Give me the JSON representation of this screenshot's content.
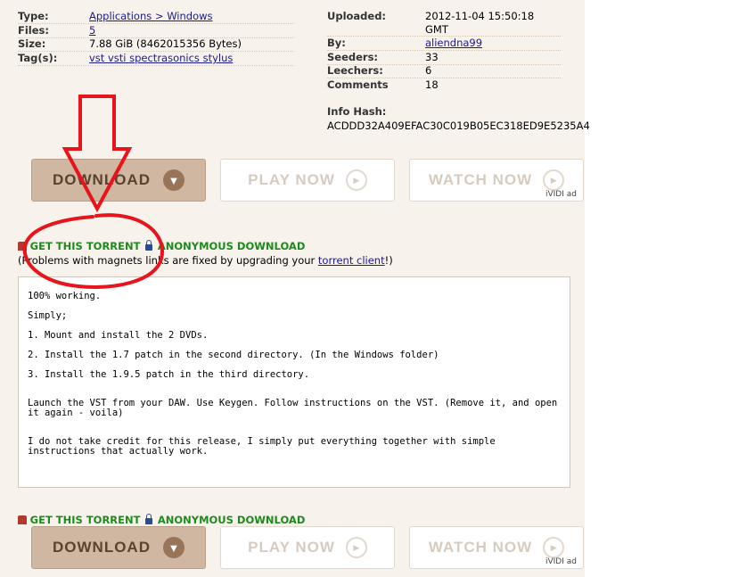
{
  "details_left": {
    "type_label": "Type:",
    "type_value": "Applications > Windows",
    "files_label": "Files:",
    "files_value": "5",
    "size_label": "Size:",
    "size_value": "7.88 GiB (8462015356 Bytes)",
    "tags_label": "Tag(s):",
    "tags_value": "vst vsti spectrasonics stylus"
  },
  "details_right": {
    "uploaded_label": "Uploaded:",
    "uploaded_value": "2012-11-04 15:50:18",
    "uploaded_tz": "GMT",
    "by_label": "By:",
    "by_value": "aliendna99",
    "seeders_label": "Seeders:",
    "seeders_value": "33",
    "leechers_label": "Leechers:",
    "leechers_value": "6",
    "comments_label": "Comments",
    "comments_value": "18",
    "infohash_label": "Info Hash:",
    "infohash_value": "ACDDD32A409EFAC30C019B05EC318ED9E5235A4"
  },
  "buttons": {
    "download": "DOWNLOAD",
    "play_now": "PLAY NOW",
    "watch_now": "WATCH NOW",
    "ad_label": "iVIDI ad"
  },
  "torrent_links": {
    "get_torrent": "GET THIS TORRENT",
    "anonymous": "ANONYMOUS DOWNLOAD",
    "note_prefix": "(Problems with magnets links are fixed by upgrading your ",
    "note_link": "torrent client",
    "note_suffix": "!)"
  },
  "description": [
    "100% working.",
    "Simply;",
    "1. Mount and install the 2 DVDs.",
    "2. Install the 1.7 patch in the second directory. (In the Windows folder)",
    "3. Install the 1.9.5 patch in the third directory.",
    "Launch the VST from your DAW. Use Keygen. Follow instructions on the VST. (Remove it, and open it again - voila)",
    "I do not take credit for this release, I simply put everything together with simple instructions that actually work."
  ],
  "colors": {
    "page_bg": "#f7f2ec",
    "download_bg": "#cfb7a2",
    "link_green": "#1e8a1e",
    "annotation_red": "#e8141c"
  }
}
